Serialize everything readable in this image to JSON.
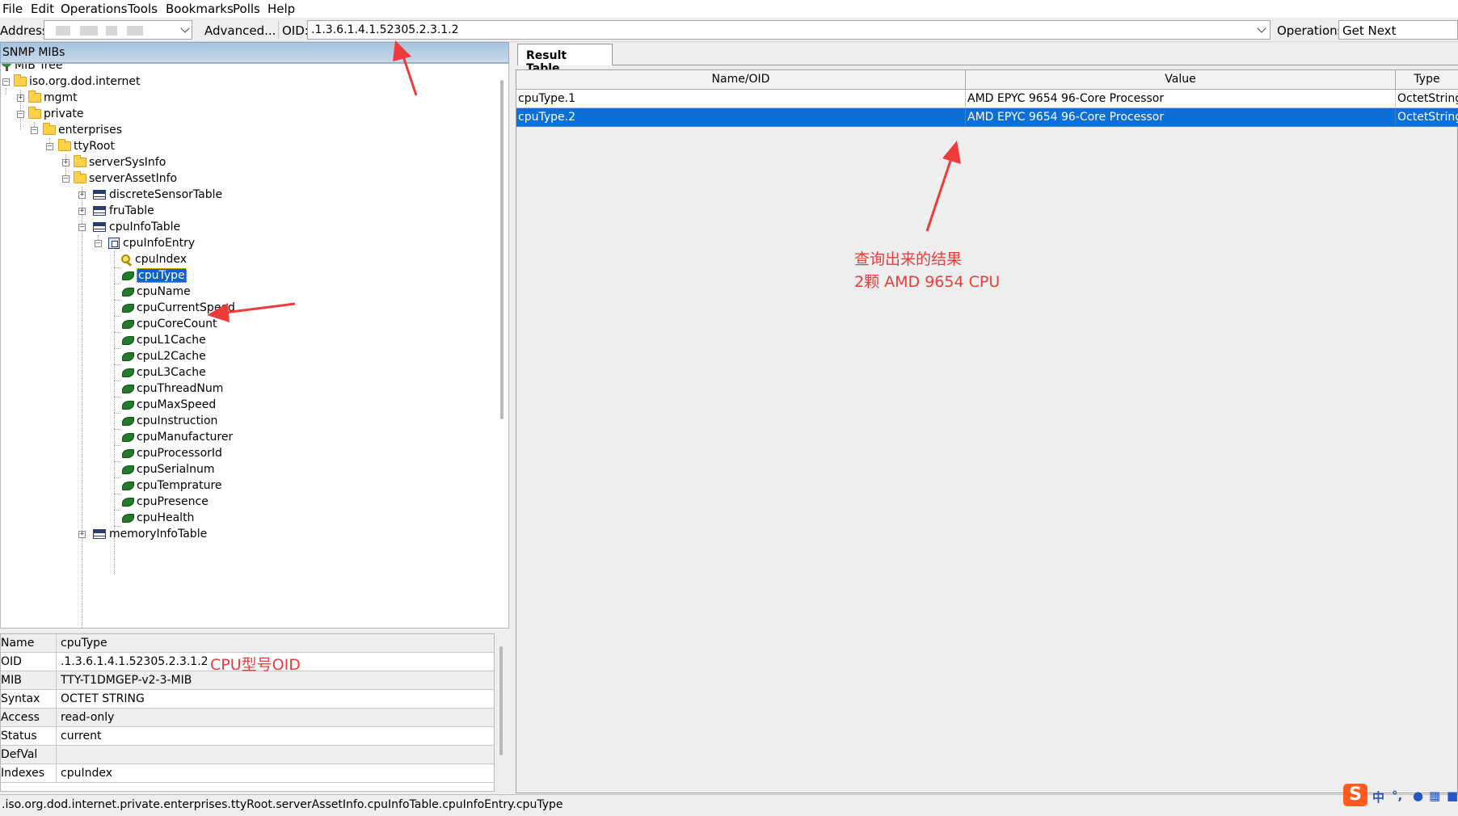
{
  "menu": [
    "File",
    "Edit",
    "Operations",
    "Tools",
    "Bookmarks",
    "Polls",
    "Help"
  ],
  "toolbar": {
    "address_label": "Address:",
    "advanced_label": "Advanced...",
    "oid_label": "OID:",
    "oid_value": ".1.3.6.1.4.1.52305.2.3.1.2",
    "operations_label": "Operations:",
    "operations_value": "Get Next"
  },
  "left": {
    "header": "SNMP MIBs",
    "tree": {
      "root": "MIB Tree",
      "nodes": {
        "iso": "iso.org.dod.internet",
        "mgmt": "mgmt",
        "private": "private",
        "enterprises": "enterprises",
        "ttyroot": "ttyRoot",
        "serversysinfo": "serverSysInfo",
        "serverassetinfo": "serverAssetInfo",
        "discretesensortable": "discreteSensorTable",
        "frutable": "fruTable",
        "cpuinfotable": "cpuInfoTable",
        "cpuinfoentry": "cpuInfoEntry",
        "memoryinfotable": "memoryInfoTable"
      },
      "leaves": [
        "cpuIndex",
        "cpuType",
        "cpuName",
        "cpuCurrentSpeed",
        "cpuCoreCount",
        "cpuL1Cache",
        "cpuL2Cache",
        "cpuL3Cache",
        "cpuThreadNum",
        "cpuMaxSpeed",
        "cpuInstruction",
        "cpuManufacturer",
        "cpuProcessorId",
        "cpuSerialnum",
        "cpuTemprature",
        "cpuPresence",
        "cpuHealth"
      ],
      "selected": "cpuType"
    },
    "props": [
      {
        "key": "Name",
        "value": "cpuType"
      },
      {
        "key": "OID",
        "value": ".1.3.6.1.4.1.52305.2.3.1.2"
      },
      {
        "key": "MIB",
        "value": "TTY-T1DMGEP-v2-3-MIB"
      },
      {
        "key": "Syntax",
        "value": "OCTET STRING"
      },
      {
        "key": "Access",
        "value": "read-only"
      },
      {
        "key": "Status",
        "value": "current"
      },
      {
        "key": "DefVal",
        "value": ""
      },
      {
        "key": "Indexes",
        "value": "cpuIndex"
      }
    ]
  },
  "right": {
    "tab": "Result Table",
    "columns": [
      "Name/OID",
      "Value",
      "Type"
    ],
    "rows": [
      {
        "name": "cpuType.1",
        "value": "AMD EPYC 9654 96-Core Processor",
        "type": "OctetString",
        "selected": false
      },
      {
        "name": "cpuType.2",
        "value": "AMD EPYC 9654 96-Core Processor",
        "type": "OctetString",
        "selected": true
      }
    ]
  },
  "status": ".iso.org.dod.internet.private.enterprises.ttyRoot.serverAssetInfo.cpuInfoTable.cpuInfoEntry.cpuType",
  "annotations": {
    "result_line1": "查询出来的结果",
    "result_line2": "2颗 AMD 9654 CPU",
    "oid_note": "CPU型号OID"
  },
  "tray": {
    "ime": "中",
    "punct": "°,"
  },
  "colors": {
    "annotation": "#ee3b3b",
    "selection": "#0a6fd6",
    "accent_header": "#a7c3dd"
  }
}
